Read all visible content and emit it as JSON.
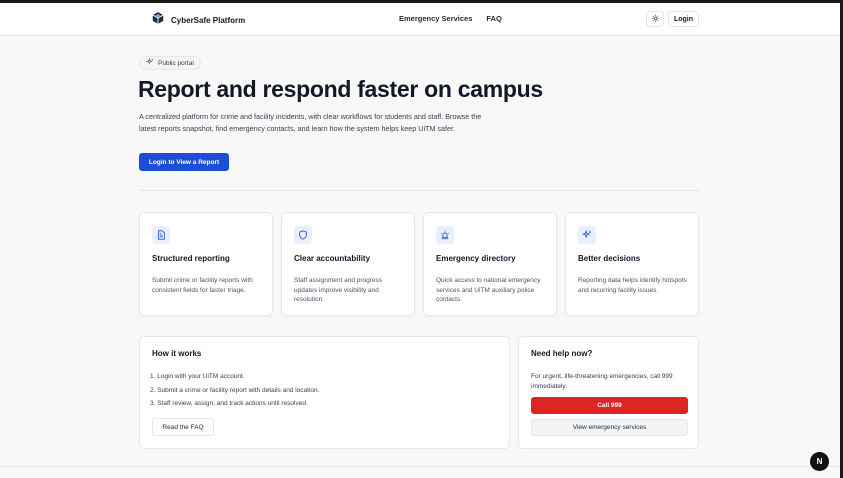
{
  "header": {
    "brand": "CyberSafe Platform",
    "nav": [
      "Emergency Services",
      "FAQ"
    ],
    "login_label": "Login"
  },
  "hero": {
    "badge": "Public portal",
    "title": "Report and respond faster on campus",
    "description": "A centralized platform for crime and facility incidents, with clear workflows for students and staff. Browse the latest reports snapshot, find emergency contacts, and learn how the system helps keep UiTM safer.",
    "cta_label": "Login to View a Report"
  },
  "features": [
    {
      "icon": "document-icon",
      "title": "Structured reporting",
      "desc": "Submit crime or facility reports with consistent fields for faster triage."
    },
    {
      "icon": "shield-icon",
      "title": "Clear accountability",
      "desc": "Staff assignment and progress updates improve visibility and resolution."
    },
    {
      "icon": "siren-icon",
      "title": "Emergency directory",
      "desc": "Quick access to national emergency services and UiTM auxiliary police contacts."
    },
    {
      "icon": "sparkles-icon",
      "title": "Better decisions",
      "desc": "Reporting data helps identify hotspots and recurring facility issues."
    }
  ],
  "how_it_works": {
    "title": "How it works",
    "steps": [
      "1. Login with your UiTM account.",
      "2. Submit a crime or facility report with details and location.",
      "3. Staff review, assign, and track actions until resolved."
    ],
    "faq_label": "Read the FAQ"
  },
  "help": {
    "title": "Need help now?",
    "desc": "For urgent, life-threatening emergencies, call 999 immediately.",
    "call_label": "Call 999",
    "view_label": "View emergency services"
  },
  "dev_badge": "N",
  "colors": {
    "primary": "#1d4ed8",
    "danger": "#dc2626",
    "icon_bg": "#e8efff"
  }
}
